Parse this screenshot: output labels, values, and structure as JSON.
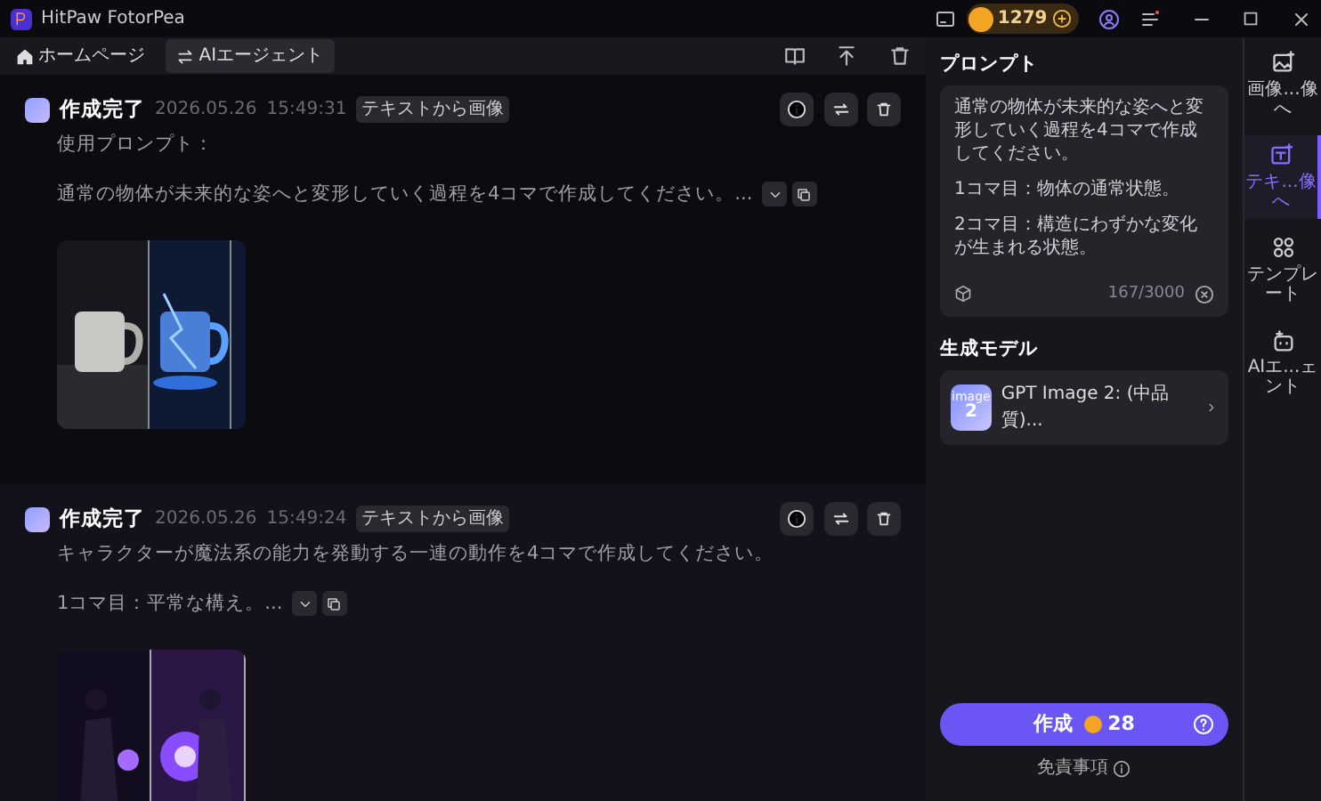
{
  "window": {
    "title": "HitPaw FotorPea"
  },
  "credits": "1279",
  "nav_tabs": [
    {
      "label": "ホームページ",
      "selected": false
    },
    {
      "label": "AIエージェント",
      "selected": true
    }
  ],
  "results": [
    {
      "status": "作成完了",
      "date": "2026.05.26",
      "time": "15:49:31",
      "tag": "テキストから画像",
      "lines": [
        "使用プロンプト：",
        "通常の物体が未来的な姿へと変形していく過程を4コマで作成してください。..."
      ],
      "image": {
        "kind": "picture"
      }
    },
    {
      "status": "作成完了",
      "date": "2026.05.26",
      "time": "15:49:24",
      "tag": "テキストから画像",
      "lines": [
        "キャラクターが魔法系の能力を発動する一連の動作を4コマで作成してください。",
        "1コマ目：平常な構え。..."
      ],
      "image": {
        "kind": "picture"
      }
    }
  ],
  "prompt": {
    "label": "プロンプト",
    "lines": [
      "通常の物体が未来的な姿へと変形していく過程を4コマで作成してください。",
      "1コマ目：物体の通常状態。",
      "2コマ目：構造にわずかな変化が生まれる状態。"
    ],
    "count": "167/3000"
  },
  "model": {
    "label": "生成モデル",
    "thumb_word": "image",
    "thumb_number": "2",
    "name": "GPT Image 2: (中品質)..."
  },
  "create_button": {
    "label": "作成",
    "cost": "28"
  },
  "disclaimer": "免責事項",
  "rail": [
    {
      "label": "画像...像へ",
      "selected": false
    },
    {
      "label": "テキ...像へ",
      "selected": true
    },
    {
      "label": "テンプレート",
      "selected": false
    },
    {
      "label": "AIエ...ェント",
      "selected": false
    }
  ]
}
